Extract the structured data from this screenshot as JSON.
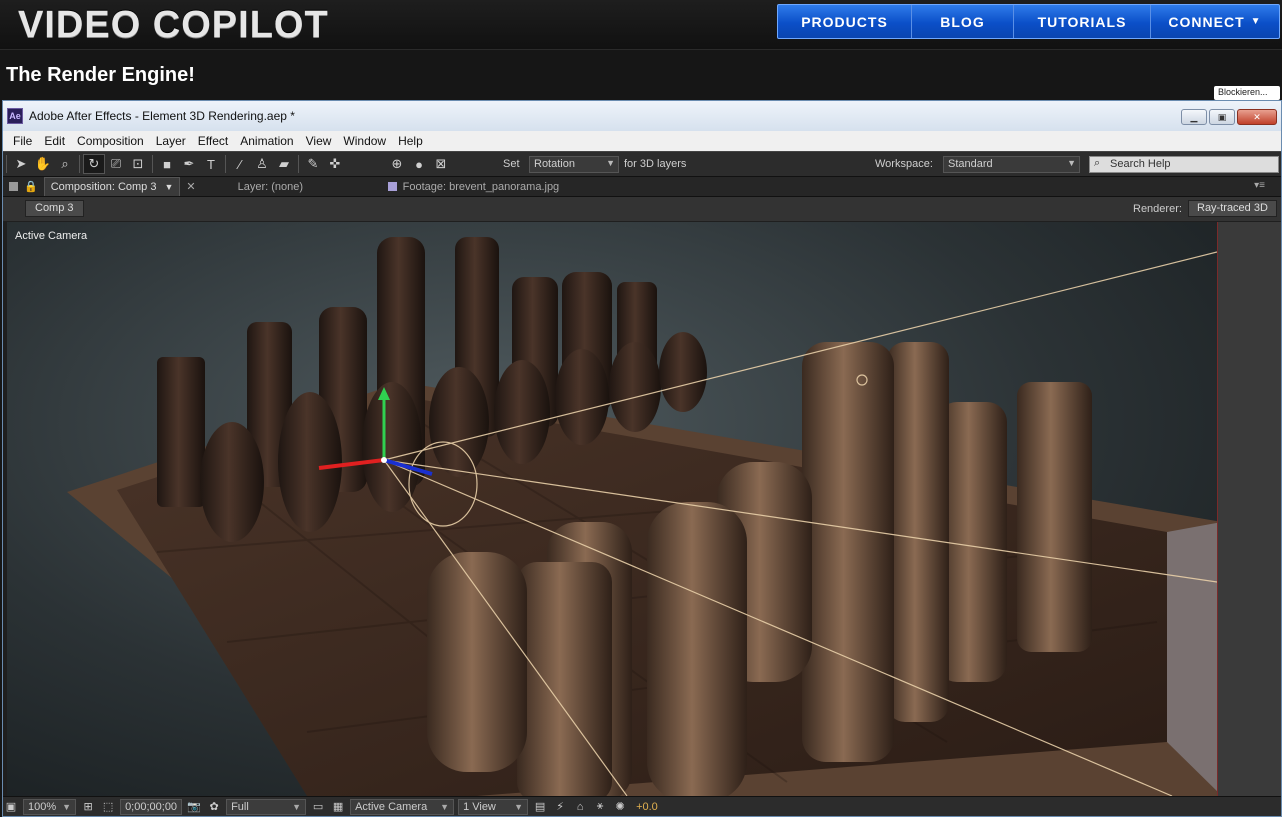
{
  "site": {
    "logo": "VIDEO COPILOT",
    "nav": [
      "PRODUCTS",
      "BLOG",
      "TUTORIALS",
      "CONNECT"
    ],
    "connect_caret": "▼",
    "page_title": "The Render Engine!",
    "block_tip": "Blockieren..."
  },
  "window": {
    "app_icon": "Ae",
    "title": "Adobe After Effects - Element 3D Rendering.aep *",
    "buttons": [
      "minimize-icon",
      "restore-icon",
      "close-icon"
    ]
  },
  "menu": [
    "File",
    "Edit",
    "Composition",
    "Layer",
    "Effect",
    "Animation",
    "View",
    "Window",
    "Help"
  ],
  "toolbar": {
    "tools": [
      "selection-tool-icon",
      "hand-tool-icon",
      "zoom-tool-icon",
      "rotation-tool-icon",
      "camera-tool-icon",
      "pan-behind-icon",
      "rectangle-tool-icon",
      "pen-tool-icon",
      "type-tool-icon",
      "brush-tool-icon",
      "clone-stamp-icon",
      "eraser-icon",
      "roto-brush-icon",
      "puppet-pin-icon"
    ],
    "set_label": "Set",
    "rotation_value": "Rotation",
    "for_3d": "for 3D layers",
    "workspace_label": "Workspace:",
    "workspace_value": "Standard",
    "search_placeholder": "Search Help"
  },
  "panels": {
    "composition_tab": "Composition: Comp 3",
    "layer_tab": "Layer: (none)",
    "footage_tab": "Footage: brevent_panorama.jpg"
  },
  "comp_bar": {
    "comp_button": "Comp 3",
    "renderer_label": "Renderer:",
    "renderer_value": "Ray-traced 3D"
  },
  "viewer": {
    "camera_label": "Active Camera"
  },
  "statusbar": {
    "zoom": "100%",
    "timecode": "0;00;00;00",
    "resolution": "Full",
    "view_camera": "Active Camera",
    "view_layout": "1 View",
    "exposure": "+0.0"
  },
  "colors": {
    "nav_blue": "#0b4fc8",
    "ae_dark": "#1f1f1f",
    "wood_dark": "#3a2a22",
    "wood_light": "#6a4e3c"
  }
}
